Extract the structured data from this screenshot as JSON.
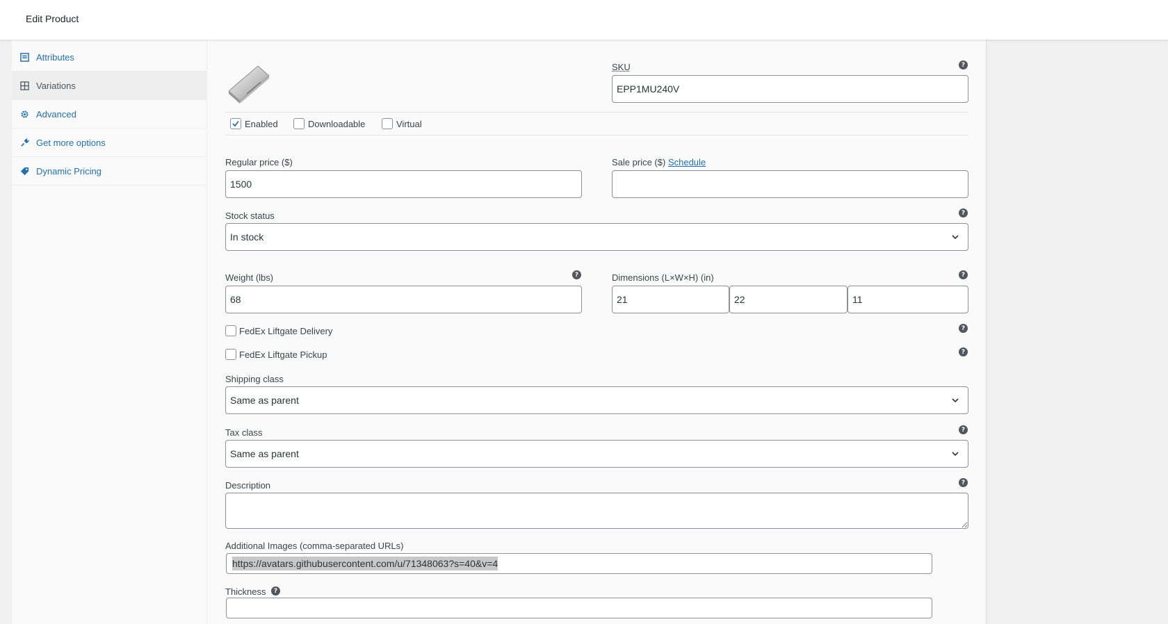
{
  "header": {
    "title": "Edit Product"
  },
  "tabs": [
    {
      "label": "Attributes",
      "icon": "list-icon"
    },
    {
      "label": "Variations",
      "icon": "grid-icon",
      "active": true
    },
    {
      "label": "Advanced",
      "icon": "gear-icon"
    },
    {
      "label": "Get more options",
      "icon": "plug-icon"
    },
    {
      "label": "Dynamic Pricing",
      "icon": "tag-icon"
    }
  ],
  "variation": {
    "sku_label": "SKU",
    "sku_value": "EPP1MU240V",
    "checkboxes": {
      "enabled": {
        "label": "Enabled",
        "checked": true
      },
      "downloadable": {
        "label": "Downloadable",
        "checked": false
      },
      "virtual": {
        "label": "Virtual",
        "checked": false
      }
    },
    "regular_price_label": "Regular price ($)",
    "regular_price_value": "1500",
    "sale_price_label": "Sale price ($)",
    "sale_price_link": "Schedule",
    "sale_price_value": "",
    "stock_status_label": "Stock status",
    "stock_status_value": "In stock",
    "weight_label": "Weight (lbs)",
    "weight_value": "68",
    "dimensions_label": "Dimensions (L×W×H) (in)",
    "dim_length": "21",
    "dim_width": "22",
    "dim_height": "11",
    "fedex_delivery_label": "FedEx Liftgate Delivery",
    "fedex_pickup_label": "FedEx Liftgate Pickup",
    "shipping_class_label": "Shipping class",
    "shipping_class_value": "Same as parent",
    "tax_class_label": "Tax class",
    "tax_class_value": "Same as parent",
    "description_label": "Description",
    "additional_images_label": "Additional Images (comma-separated URLs)",
    "additional_images_value": "https://avatars.githubusercontent.com/u/71348063?s=40&v=4",
    "thickness_label": "Thickness",
    "thickness_value": ""
  },
  "colors": {
    "link": "#2271b1",
    "border": "#8c8f94",
    "text": "#3c434a"
  }
}
